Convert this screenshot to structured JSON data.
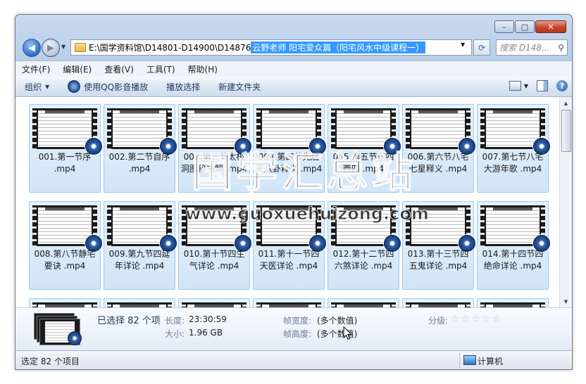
{
  "window": {
    "controls": {
      "minimize": "–",
      "maximize": "□",
      "close": "✕"
    }
  },
  "nav": {
    "address_path": "E:\\国学资料馆\\D14801-D14900\\D14876",
    "address_selected": "云野老师 阳宅爱众篇（阳宅风水中级课程一）",
    "search_placeholder": "搜索 D148..."
  },
  "menu": [
    "文件(F)",
    "编辑(E)",
    "查看(V)",
    "工具(T)",
    "帮助(H)"
  ],
  "toolbar": {
    "organize": "组织",
    "play_qq": "使用QQ影音播放",
    "play_selection": "播放选择",
    "new_folder": "新建文件夹"
  },
  "files": [
    {
      "line1": "001.第一节序",
      "line2": ".mp4"
    },
    {
      "line1": "002.第二节自序",
      "line2": ".mp4"
    },
    {
      "line1": "003.第三节太极",
      "line2": "洞图秘书解 .mp4"
    },
    {
      "line1": "004.第四节先后",
      "line2": "天八卦释义 .mp4"
    },
    {
      "line1": "005.第五节东四",
      "line2": "西四 .mp4"
    },
    {
      "line1": "006.第六节八宅",
      "line2": "七星释义 .mp4"
    },
    {
      "line1": "007.第七节八宅",
      "line2": "大游年歌 .mp4"
    },
    {
      "line1": "008.第八节静宅",
      "line2": "要诀 .mp4"
    },
    {
      "line1": "009.第九节四延",
      "line2": "年详论 .mp4"
    },
    {
      "line1": "010.第十节四生",
      "line2": "气详论 .mp4"
    },
    {
      "line1": "011.第十一节四",
      "line2": "天医详论 .mp4"
    },
    {
      "line1": "012.第十二节四",
      "line2": "六煞详论 .mp4"
    },
    {
      "line1": "013.第十三节四",
      "line2": "五鬼详论 .mp4"
    },
    {
      "line1": "014.第十四节四",
      "line2": "绝命详论 .mp4"
    },
    {
      "line1": "",
      "line2": ""
    },
    {
      "line1": "",
      "line2": ""
    },
    {
      "line1": "",
      "line2": ""
    },
    {
      "line1": "",
      "line2": ""
    },
    {
      "line1": "",
      "line2": ""
    },
    {
      "line1": "",
      "line2": ""
    },
    {
      "line1": "",
      "line2": ""
    }
  ],
  "watermark": {
    "text": "国学汇总站",
    "url": "www.guoxuehuizong.com"
  },
  "details": {
    "selected": "已选择 82 个项",
    "length_label": "长度:",
    "length_value": "23:30:59",
    "size_label": "大小:",
    "size_value": "1.96 GB",
    "width_label": "帧宽度:",
    "width_value": "(多个数值)",
    "height_label": "帧高度:",
    "height_value": "(多个数值)",
    "rating_label": "分级:",
    "rating_stars": 0
  },
  "status": {
    "left": "选定 82 个项目",
    "right": "计算机"
  }
}
